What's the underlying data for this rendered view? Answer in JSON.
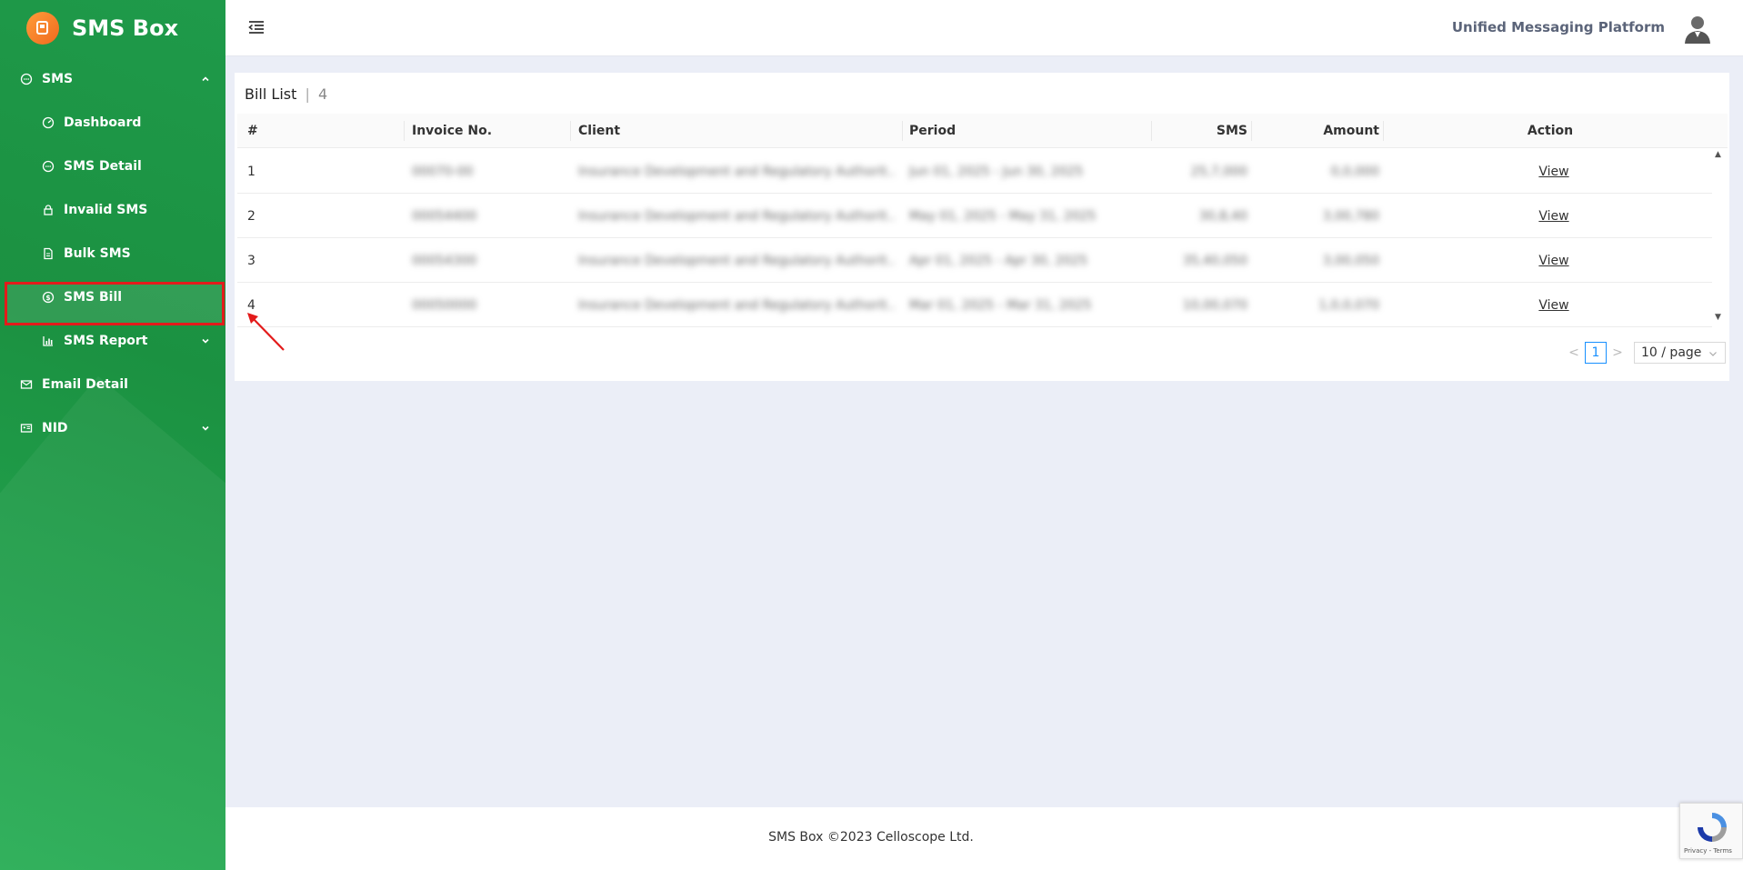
{
  "sidebar": {
    "brand": "SMS Box",
    "sms_group": "SMS",
    "items": [
      {
        "label": "Dashboard"
      },
      {
        "label": "SMS Detail"
      },
      {
        "label": "Invalid SMS"
      },
      {
        "label": "Bulk SMS"
      },
      {
        "label": "SMS Bill"
      },
      {
        "label": "SMS Report"
      }
    ],
    "email_detail": "Email Detail",
    "nid": "NID",
    "active_item": "SMS Bill"
  },
  "header": {
    "platform_title": "Unified Messaging Platform"
  },
  "card": {
    "title": "Bill List",
    "separator": "|",
    "count": "4"
  },
  "table": {
    "columns": [
      "#",
      "Invoice No.",
      "Client",
      "Period",
      "SMS",
      "Amount",
      "Action"
    ],
    "rows": [
      {
        "index": "1",
        "invoice": "00070-00",
        "client": "Insurance Development and Regulatory Authorit...",
        "period": "Jun 01, 2025 - Jun 30, 2025",
        "sms": "25,7,000",
        "amount": "0,0,000",
        "action": "View"
      },
      {
        "index": "2",
        "invoice": "00054400",
        "client": "Insurance Development and Regulatory Authorit...",
        "period": "May 01, 2025 - May 31, 2025",
        "sms": "30,8,40",
        "amount": "3,00,780",
        "action": "View"
      },
      {
        "index": "3",
        "invoice": "00054300",
        "client": "Insurance Development and Regulatory Authorit...",
        "period": "Apr 01, 2025 - Apr 30, 2025",
        "sms": "35,40,050",
        "amount": "3,00,050",
        "action": "View"
      },
      {
        "index": "4",
        "invoice": "00050000",
        "client": "Insurance Development and Regulatory Authorit...",
        "period": "Mar 01, 2025 - Mar 31, 2025",
        "sms": "10,00,070",
        "amount": "1,0,0,070",
        "action": "View"
      }
    ]
  },
  "pagination": {
    "prev": "<",
    "current_page": "1",
    "next": ">",
    "page_size": "10 / page"
  },
  "footer": {
    "text": "SMS Box ©2023 Celloscope Ltd."
  },
  "recaptcha": {
    "text": "Privacy - Terms"
  },
  "colors": {
    "sidebar_green": "#1f9a4a",
    "highlight_red": "#e31b1b",
    "pager_blue": "#1890ff",
    "background": "#ebeef7"
  },
  "icons": {
    "sms_group": "chat-bubble-icon",
    "dashboard": "gauge-icon",
    "sms_detail": "chat-bubble-icon",
    "invalid_sms": "lock-icon",
    "bulk_sms": "document-icon",
    "sms_bill": "dollar-circle-icon",
    "sms_report": "bar-chart-icon",
    "email_detail": "envelope-icon",
    "nid": "id-card-icon"
  }
}
